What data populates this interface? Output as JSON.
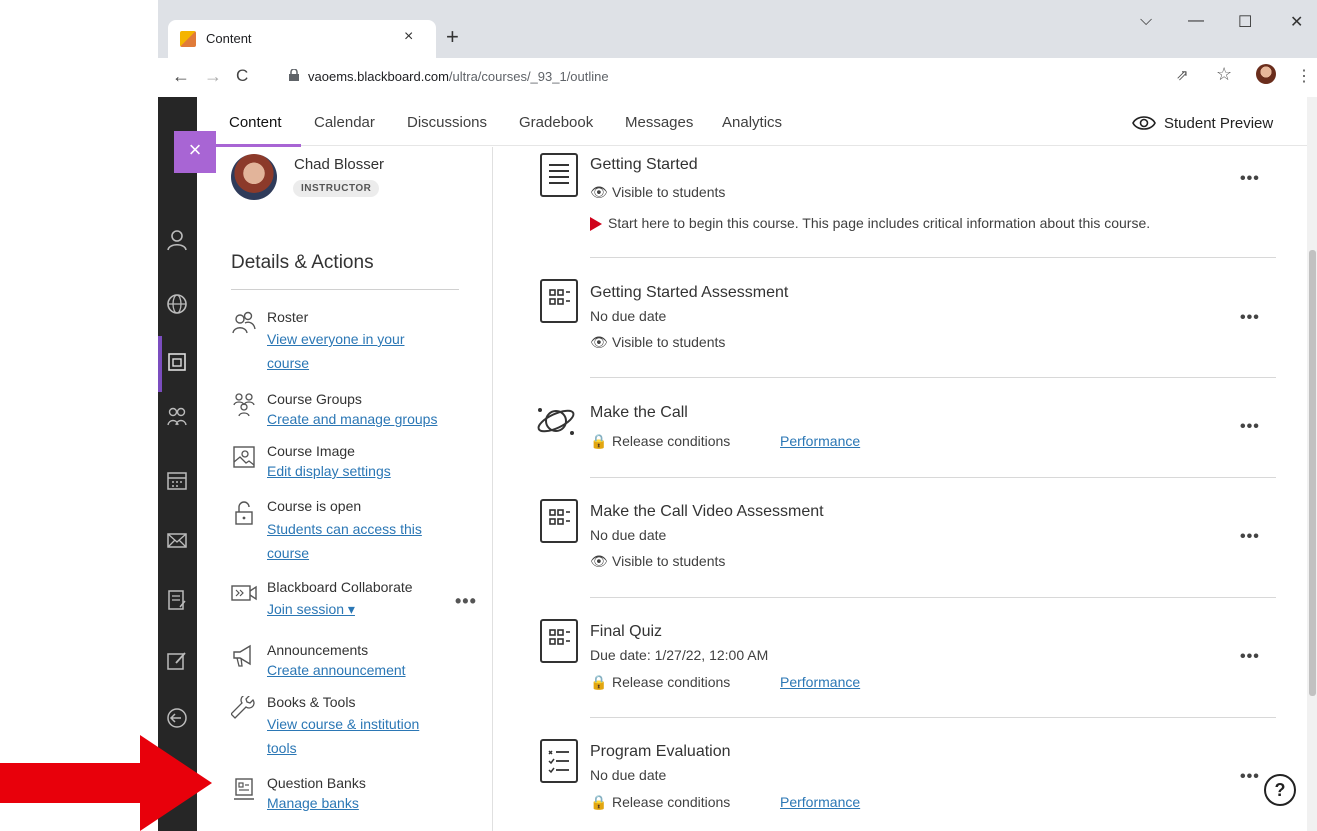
{
  "browser": {
    "tab_title": "Content",
    "tab_close": "×",
    "new_tab": "+",
    "url_host": "vaoems.blackboard.com",
    "url_path": "/ultra/courses/_93_1/outline",
    "nav": {
      "back": "←",
      "forward": "→",
      "reload": "C"
    },
    "win": {
      "dropdown": "⌵",
      "minimize": "—",
      "maximize": "☐",
      "close": "✕"
    },
    "share": "⇗",
    "star": "☆",
    "menu": "⋮"
  },
  "topnav": {
    "items": [
      "Content",
      "Calendar",
      "Discussions",
      "Gradebook",
      "Messages",
      "Analytics"
    ],
    "student_preview": "Student Preview"
  },
  "panel": {
    "close": "×",
    "instructor_name": "Chad Blosser",
    "role": "INSTRUCTOR",
    "details_title": "Details & Actions",
    "actions": [
      {
        "title": "Roster",
        "link": "View everyone in your",
        "link2": "course"
      },
      {
        "title": "Course Groups",
        "link": "Create and manage groups"
      },
      {
        "title": "Course Image",
        "link": "Edit display settings"
      },
      {
        "title": "Course is open",
        "link": "Students can access this",
        "link2": "course"
      },
      {
        "title": "Blackboard Collaborate",
        "link": "Join session ▾"
      },
      {
        "title": "Announcements",
        "link": "Create announcement"
      },
      {
        "title": "Books & Tools",
        "link": "View course & institution",
        "link2": "tools"
      },
      {
        "title": "Question Banks",
        "link": "Manage banks"
      }
    ],
    "more": "•••"
  },
  "content": {
    "items": [
      {
        "title": "Getting Started",
        "line1": "Visible to students",
        "line2": "Start here to begin this course. This page includes critical information about this course."
      },
      {
        "title": "Getting Started Assessment",
        "line1": "No due date",
        "line2": "Visible to students"
      },
      {
        "title": "Make the Call",
        "line1": "Release conditions",
        "perf": "Performance"
      },
      {
        "title": "Make the Call Video Assessment",
        "line1": "No due date",
        "line2": "Visible to students"
      },
      {
        "title": "Final Quiz",
        "line1": "Due date: 1/27/22, 12:00 AM",
        "line2": "Release conditions",
        "perf": "Performance"
      },
      {
        "title": "Program Evaluation",
        "line1": "No due date",
        "line2": "Release conditions",
        "perf": "Performance"
      }
    ],
    "more": "•••"
  },
  "help": "?",
  "colors": {
    "accent": "#a865d4",
    "link": "#2b77b5",
    "annotation_arrow": "#e8000b"
  }
}
